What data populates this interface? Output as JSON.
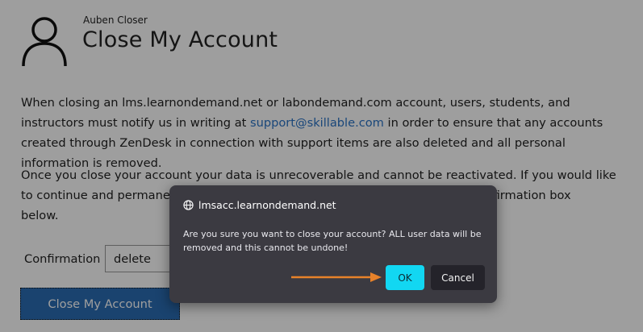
{
  "header": {
    "user_name": "Auben Closer",
    "title": "Close My Account",
    "avatar_icon": "user-silhouette-icon"
  },
  "body": {
    "para1_before": "When closing an lms.learnondemand.net or labondemand.com account, users, students, and instructors must notify us in writing at ",
    "para1_link": "support@skillable.com",
    "para1_after": " in order to ensure that any accounts created through ZenDesk in connection with support items are also deleted and all personal information is removed.",
    "para2_left": "Once you close your account your data is unrecoverable and cannot be reactivated. If you would like to continue and permanently remove yo",
    "para2_right": "e confirmation box",
    "para2_end": "below."
  },
  "form": {
    "confirm_label": "Confirmation",
    "confirm_value": "delete",
    "close_button": "Close My Account"
  },
  "dialog": {
    "origin": "lmsacc.learnondemand.net",
    "origin_icon": "globe-icon",
    "message": "Are you sure you want to close your account?  ALL user data will be removed and this cannot be undone!",
    "ok_label": "OK",
    "cancel_label": "Cancel"
  },
  "colors": {
    "accent_link": "#2a73c6",
    "primary_button": "#2b6cb3",
    "dialog_bg": "#3b3a41",
    "ok_button": "#12d7f2",
    "annotation_arrow": "#e8822a"
  }
}
